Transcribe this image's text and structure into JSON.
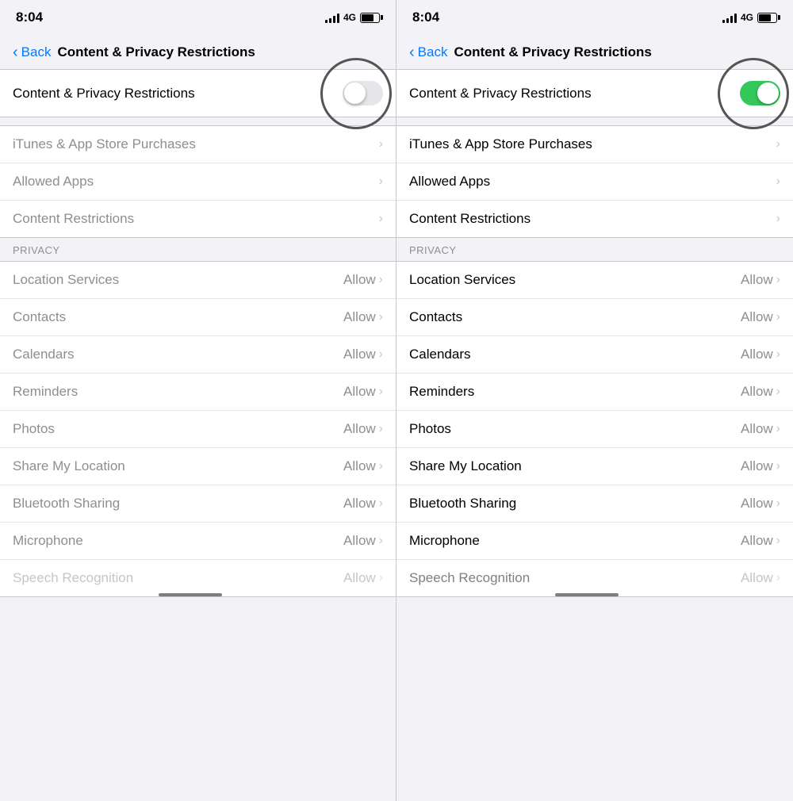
{
  "left_panel": {
    "status": {
      "time": "8:04",
      "network": "4G"
    },
    "nav": {
      "back_label": "Back",
      "title": "Content & Privacy Restrictions"
    },
    "toggle": {
      "label": "Content & Privacy Restrictions",
      "state": "off"
    },
    "menu_items": [
      {
        "label": "iTunes & App Store Purchases",
        "right": "",
        "chevron": "›"
      },
      {
        "label": "Allowed Apps",
        "right": "",
        "chevron": "›"
      },
      {
        "label": "Content Restrictions",
        "right": "",
        "chevron": "›"
      }
    ],
    "privacy_section": {
      "header": "PRIVACY",
      "items": [
        {
          "label": "Location Services",
          "right": "Allow",
          "chevron": "›"
        },
        {
          "label": "Contacts",
          "right": "Allow",
          "chevron": "›"
        },
        {
          "label": "Calendars",
          "right": "Allow",
          "chevron": "›"
        },
        {
          "label": "Reminders",
          "right": "Allow",
          "chevron": "›"
        },
        {
          "label": "Photos",
          "right": "Allow",
          "chevron": "›"
        },
        {
          "label": "Share My Location",
          "right": "Allow",
          "chevron": "›"
        },
        {
          "label": "Bluetooth Sharing",
          "right": "Allow",
          "chevron": "›"
        },
        {
          "label": "Microphone",
          "right": "Allow",
          "chevron": "›"
        },
        {
          "label": "Speech Recognition",
          "right": "Allow",
          "chevron": "›"
        }
      ]
    }
  },
  "right_panel": {
    "status": {
      "time": "8:04",
      "network": "4G"
    },
    "nav": {
      "back_label": "Back",
      "title": "Content & Privacy Restrictions"
    },
    "toggle": {
      "label": "Content & Privacy Restrictions",
      "state": "on"
    },
    "menu_items": [
      {
        "label": "iTunes & App Store Purchases",
        "right": "",
        "chevron": "›"
      },
      {
        "label": "Allowed Apps",
        "right": "",
        "chevron": "›"
      },
      {
        "label": "Content Restrictions",
        "right": "",
        "chevron": "›"
      }
    ],
    "privacy_section": {
      "header": "PRIVACY",
      "items": [
        {
          "label": "Location Services",
          "right": "Allow",
          "chevron": "›"
        },
        {
          "label": "Contacts",
          "right": "Allow",
          "chevron": "›"
        },
        {
          "label": "Calendars",
          "right": "Allow",
          "chevron": "›"
        },
        {
          "label": "Reminders",
          "right": "Allow",
          "chevron": "›"
        },
        {
          "label": "Photos",
          "right": "Allow",
          "chevron": "›"
        },
        {
          "label": "Share My Location",
          "right": "Allow",
          "chevron": "›"
        },
        {
          "label": "Bluetooth Sharing",
          "right": "Allow",
          "chevron": "›"
        },
        {
          "label": "Microphone",
          "right": "Allow",
          "chevron": "›"
        },
        {
          "label": "Speech Recognition",
          "right": "Allow",
          "chevron": "›"
        }
      ]
    }
  }
}
